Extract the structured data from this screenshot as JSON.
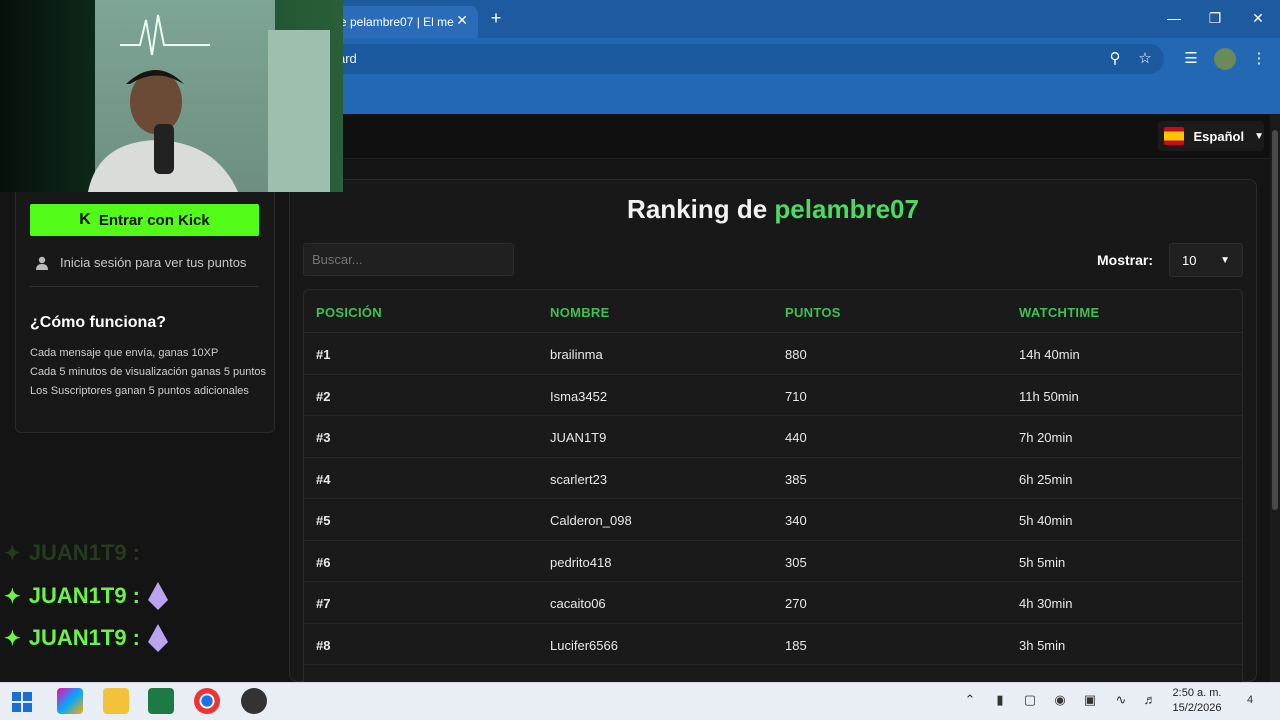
{
  "browser": {
    "tab_title": "e pelambre07 | El me",
    "tab_close": "✕",
    "new_tab": "+",
    "url": "ard",
    "window": {
      "minimize": "—",
      "restore": "❐",
      "close": "✕"
    }
  },
  "header": {
    "language": "Español"
  },
  "sidebar": {
    "kick_button": "Entrar con Kick",
    "login_hint": "Inicia sesión para ver tus puntos",
    "how_title": "¿Cómo funciona?",
    "how_lines": [
      "Cada mensaje que envía, ganas 10XP",
      "Cada 5 minutos de visualización ganas 5 puntos",
      "Los Suscriptores ganan 5 puntos adicionales"
    ]
  },
  "ranking": {
    "title_prefix": "Ranking de",
    "title_user": "pelambre07",
    "search_placeholder": "Buscar...",
    "show_label": "Mostrar:",
    "show_value": "10",
    "columns": [
      "POSICIÓN",
      "NOMBRE",
      "PUNTOS",
      "WATCHTIME"
    ],
    "rows": [
      {
        "pos": "#1",
        "name": "brailinma",
        "points": "880",
        "watch": "14h 40min"
      },
      {
        "pos": "#2",
        "name": "Isma3452",
        "points": "710",
        "watch": "11h 50min"
      },
      {
        "pos": "#3",
        "name": "JUAN1T9",
        "points": "440",
        "watch": "7h 20min"
      },
      {
        "pos": "#4",
        "name": "scarlert23",
        "points": "385",
        "watch": "6h 25min"
      },
      {
        "pos": "#5",
        "name": "Calderon_098",
        "points": "340",
        "watch": "5h 40min"
      },
      {
        "pos": "#6",
        "name": "pedrito418",
        "points": "305",
        "watch": "5h 5min"
      },
      {
        "pos": "#7",
        "name": "cacaito06",
        "points": "270",
        "watch": "4h 30min"
      },
      {
        "pos": "#8",
        "name": "Lucifer6566",
        "points": "185",
        "watch": "3h 5min"
      }
    ]
  },
  "chat_overlay": {
    "lines": [
      "JUAN1T9 :",
      "JUAN1T9 :",
      "JUAN1T9 :"
    ]
  },
  "taskbar": {
    "time": "2:50 a. m.",
    "date": "15/2/2026",
    "notif_count": "4"
  }
}
